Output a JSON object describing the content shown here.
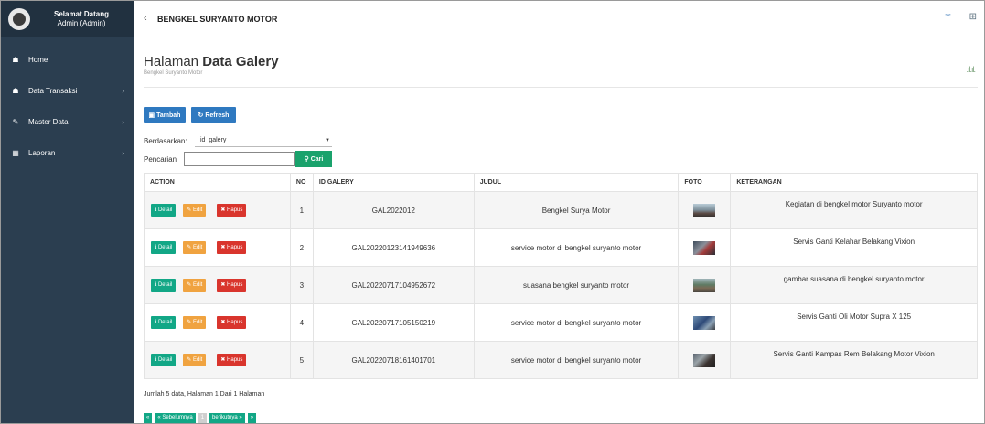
{
  "sidebar": {
    "welcome": "Selamat Datang",
    "user": "Admin (Admin)",
    "items": [
      {
        "icon": "home-icon",
        "glyph": "☗",
        "label": "Home",
        "arrow": ""
      },
      {
        "icon": "home-icon",
        "glyph": "☗",
        "label": "Data Transaksi",
        "arrow": "›"
      },
      {
        "icon": "edit-icon",
        "glyph": "✎",
        "label": "Master Data",
        "arrow": "›"
      },
      {
        "icon": "calendar-icon",
        "glyph": "▦",
        "label": "Laporan",
        "arrow": "›"
      }
    ]
  },
  "header": {
    "back": "‹",
    "brand": "BENGKEL SURYANTO MOTOR"
  },
  "page": {
    "title_plain": "Halaman",
    "title_bold": "Data Galery",
    "subtitle": "Bengkel Suryanto Motor"
  },
  "toolbar": {
    "tambah": "Tambah",
    "refresh": "Refresh"
  },
  "filter": {
    "by_label": "Berdasarkan:",
    "by_value": "id_galery",
    "search_label": "Pencarian",
    "search_value": "",
    "search_button": "Cari"
  },
  "table": {
    "headers": [
      "ACTION",
      "NO",
      "ID GALERY",
      "JUDUL",
      "FOTO",
      "KETERANGAN"
    ],
    "actions": {
      "detail": "Detail",
      "edit": "Edit",
      "hapus": "Hapus"
    },
    "rows": [
      {
        "no": "1",
        "id": "GAL2022012",
        "judul": "Bengkel Surya Motor",
        "ket": "Kegiatan di bengkel motor Suryanto motor"
      },
      {
        "no": "2",
        "id": "GAL20220123141949636",
        "judul": "service motor di bengkel suryanto motor",
        "ket": "Servis Ganti Kelahar Belakang Vixion"
      },
      {
        "no": "3",
        "id": "GAL20220717104952672",
        "judul": "suasana bengkel suryanto motor",
        "ket": "gambar suasana di bengkel suryanto motor"
      },
      {
        "no": "4",
        "id": "GAL20220717105150219",
        "judul": "service motor di bengkel suryanto motor",
        "ket": "Servis Ganti Oli Motor Supra X 125"
      },
      {
        "no": "5",
        "id": "GAL20220718161401701",
        "judul": "service motor di bengkel suryanto motor",
        "ket": "Servis Ganti Kampas Rem Belakang Motor Vixion"
      }
    ]
  },
  "footer": {
    "summary": "Jumlah 5 data, Halaman 1 Dari 1 Halaman",
    "first": "«",
    "prev": "« Sebelumnya",
    "page": "1",
    "next": "berikutnya »",
    "last": "»"
  },
  "colors": {
    "sidebar": "#2b3e50",
    "primary": "#2f79c0",
    "success": "#12a786",
    "warning": "#f0a340",
    "danger": "#d9352d"
  }
}
